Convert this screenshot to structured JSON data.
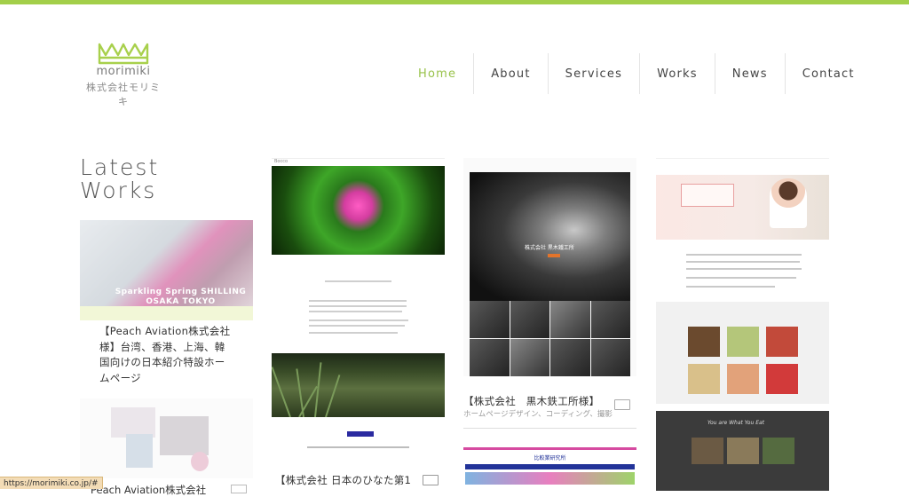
{
  "logo": {
    "en": "morimiki",
    "jp": "株式会社モリミキ"
  },
  "nav": {
    "items": [
      {
        "label": "Home"
      },
      {
        "label": "About"
      },
      {
        "label": "Services"
      },
      {
        "label": "Works"
      },
      {
        "label": "News"
      },
      {
        "label": "Contact"
      }
    ]
  },
  "heading": {
    "line1": "Latest",
    "line2": "Works"
  },
  "works": {
    "peach": {
      "caption": "Sparkling Spring SHILLING OSAKA TOKYO",
      "title": "【Peach Aviation株式会社様】台湾、香港、上海、韓国向けの日本紹介特設ホームページ",
      "title2": "Peach Aviation株式会社"
    },
    "hinata": {
      "brand": "Bocco",
      "title": "【株式会社 日本のひなた第1"
    },
    "kuroki": {
      "hero_text": "株式会社 黒木鐵工所",
      "title": "【株式会社　黒木鉄工所様】",
      "subtitle": "ホームページデザイン、コーディング、撮影"
    },
    "hikaku": {
      "title": "比較業研究所"
    },
    "shoku": {
      "slate_text": "You are What You Eat"
    }
  },
  "status": {
    "url": "https://morimiki.co.jp/#"
  },
  "colors": {
    "accent": "#98c24a",
    "topbar": "#a3cf4a"
  }
}
